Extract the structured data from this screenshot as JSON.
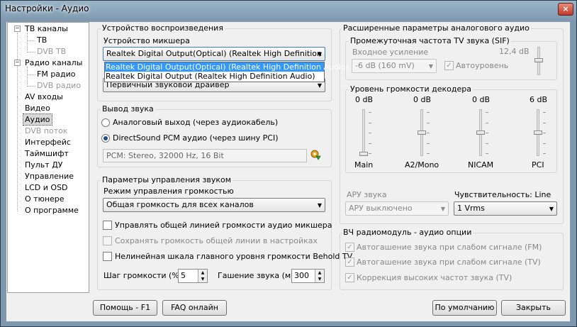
{
  "window": {
    "title": "Настройки - Аудио",
    "close_label": "×"
  },
  "nav": {
    "items": [
      {
        "label": "ТВ каналы"
      },
      {
        "label": "ТВ"
      },
      {
        "label": "DVB ТВ"
      },
      {
        "label": "Радио каналы"
      },
      {
        "label": "FM радио"
      },
      {
        "label": "DVB радио"
      },
      {
        "label": "AV входы"
      },
      {
        "label": "Видео"
      },
      {
        "label": "Аудио"
      },
      {
        "label": "DVB поток"
      },
      {
        "label": "Интерфейс"
      },
      {
        "label": "Таймшифт"
      },
      {
        "label": "Пульт ДУ"
      },
      {
        "label": "Управление"
      },
      {
        "label": "LCD и OSD"
      },
      {
        "label": "О тюнере"
      },
      {
        "label": "О программе"
      }
    ]
  },
  "playback": {
    "group_label": "Устройство воспроизведения",
    "mixer_label": "Устройство микшера",
    "mixer_value": "Realtek Digital Output(Optical) (Realtek High Definition Audic",
    "mixer_options": [
      "Realtek Digital Output(Optical) (Realtek High Definition Audio)",
      "Realtek Digital Output (Realtek High Definition Audio)"
    ],
    "driver_value": "Первичный звуковой драйвер"
  },
  "output": {
    "group_label": "Вывод звука",
    "analog_label": "Аналоговый выход (через аудиокабель)",
    "directsound_label": "DirectSound PCM аудио (через шину PCI)",
    "pcm_info": "PCM: Stereo, 32000 Hz, 16 Bit"
  },
  "control": {
    "group_label": "Параметры управления звуком",
    "mode_label": "Режим управления громкостью",
    "mode_value": "Общая громкость для всех каналов",
    "manage_mixer_label": "Управлять общей линией громкости аудио микшера",
    "save_volume_label": "Сохранять громкость общей линии в настройках",
    "nonlinear_label": "Нелинейная шкала главного уровня громкости Behold TV",
    "step_label": "Шаг громкости (%)",
    "step_value": "5",
    "fade_label": "Гашение звука (мс)",
    "fade_value": "300"
  },
  "analog": {
    "group_label": "Расширенные параметры аналогового аудио",
    "sif_label": "Промежуточная частота TV звука (SIF)",
    "gain_label": "Входное усиление",
    "gain_db": "12,4 dB",
    "gain_value": "-6 dB (160 mV)",
    "auto_label": "Автоуровень",
    "decoder_label": "Уровень громкости декодера",
    "decoder_channels": [
      {
        "name": "Main",
        "db": "0 dB",
        "level": 0.0
      },
      {
        "name": "A2/Mono",
        "db": "0 dB",
        "level": 0.5
      },
      {
        "name": "NICAM",
        "db": "0 dB",
        "level": 0.5
      },
      {
        "name": "PCI",
        "db": "6 dB",
        "level": 0.5
      }
    ],
    "agc_label": "АРУ звука",
    "agc_value": "АРУ выключено",
    "sensitivity_label": "Чувствительность: Line",
    "sensitivity_value": "1 Vrms"
  },
  "rf": {
    "group_label": "ВЧ радиомодуль - аудио опции",
    "fm_mute_label": "Автогашение звука при слабом сигнале (FM)",
    "tv_mute_label": "Автогашение звука при слабом сигнале (TV)",
    "hf_label": "Коррекция высоких частот звука (TV)"
  },
  "buttons": {
    "help": "Помощь - F1",
    "faq": "FAQ онлайн",
    "defaults": "По умолчанию",
    "close": "Закрыть"
  },
  "colors": {
    "selection": "#3399ff",
    "accent": "#1a4f8a"
  }
}
